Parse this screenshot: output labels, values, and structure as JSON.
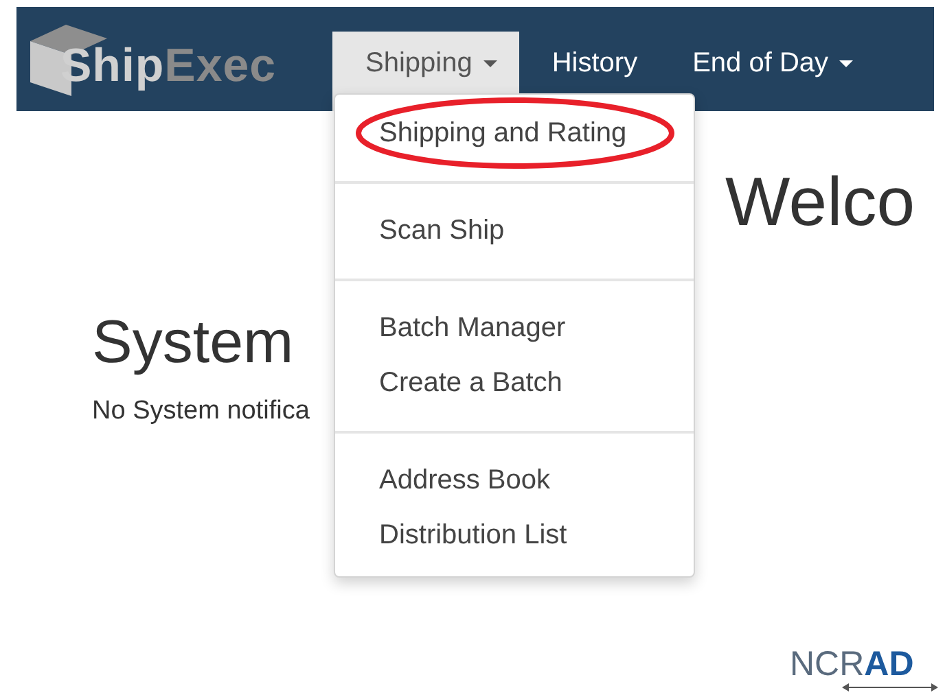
{
  "navbar": {
    "logo": {
      "part_1": "Ship",
      "part_2": "Exec"
    },
    "items": [
      {
        "label": "Shipping",
        "selected": true,
        "caret": true
      },
      {
        "label": "History",
        "selected": false,
        "caret": false
      },
      {
        "label": "End of Day",
        "selected": false,
        "caret": true
      }
    ]
  },
  "dropdown": {
    "groups": [
      {
        "items": [
          {
            "label": "Shipping and Rating",
            "circled": true
          }
        ]
      },
      {
        "items": [
          {
            "label": "Scan Ship",
            "circled": false
          }
        ]
      },
      {
        "items": [
          {
            "label": "Batch Manager",
            "circled": false
          },
          {
            "label": "Create a Batch",
            "circled": false
          }
        ]
      },
      {
        "items": [
          {
            "label": "Address Book",
            "circled": false
          },
          {
            "label": "Distribution List",
            "circled": false
          }
        ]
      }
    ]
  },
  "welcome_heading": "Welco",
  "notifications": {
    "heading": "System",
    "message": "No System notifica"
  },
  "footer_logo": {
    "part_1": "NCR",
    "part_2": "AD"
  }
}
